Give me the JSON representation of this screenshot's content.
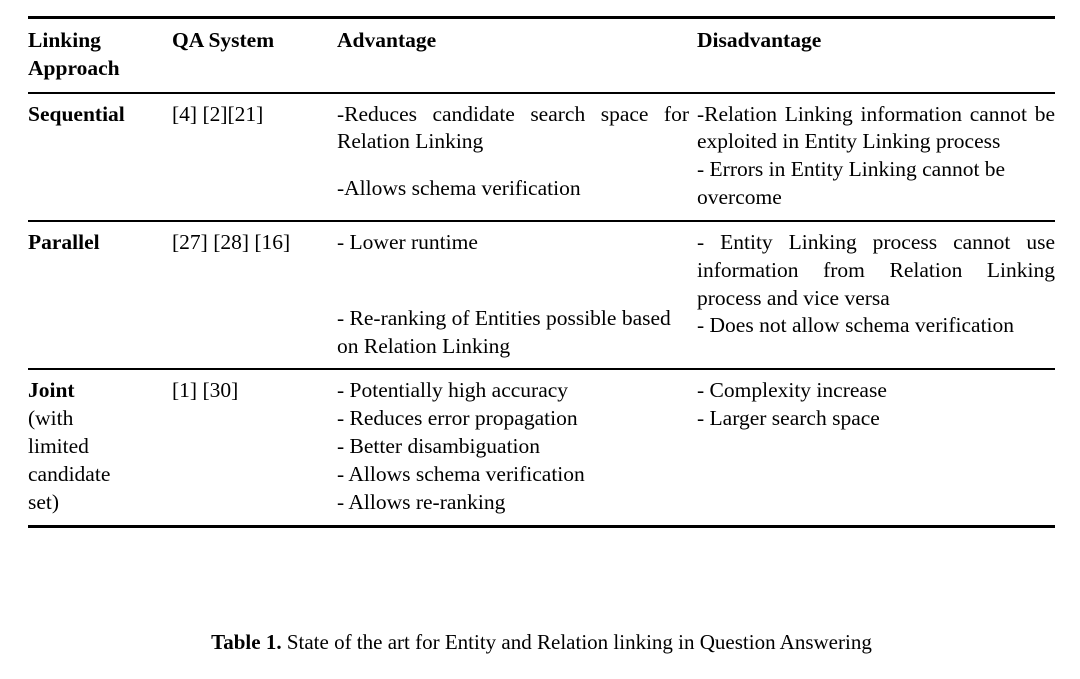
{
  "table": {
    "columns": [
      {
        "key": "approach",
        "label": "Linking\nApproach",
        "label_line1": "Linking",
        "label_line2": "Approach"
      },
      {
        "key": "qa_system",
        "label": "QA System"
      },
      {
        "key": "advantage",
        "label": "Advantage"
      },
      {
        "key": "disadvantage",
        "label": "Disadvantage"
      }
    ],
    "header": {
      "approach_line1": "Linking",
      "approach_line2": "Approach",
      "qa_system": "QA System",
      "advantage": "Advantage",
      "disadvantage": "Disadvantage"
    },
    "rows": [
      {
        "approach": "Sequential",
        "approach_sub": "",
        "qa_system": "[4] [2][21]",
        "advantages": [
          "-Reduces candidate search space for Relation Linking",
          "-Allows schema verification"
        ],
        "disadvantages": [
          "-Relation Linking information cannot be exploited in Entity Linking process",
          "- Errors in Entity Linking cannot be overcome"
        ]
      },
      {
        "approach": "Parallel",
        "approach_sub": "",
        "qa_system": "[27] [28] [16]",
        "advantages": [
          "- Lower runtime",
          "- Re-ranking of Entities possible based on Relation Linking"
        ],
        "disadvantages": [
          "- Entity Linking process cannot use information from Relation Linking process and vice versa",
          "- Does not allow schema verification"
        ]
      },
      {
        "approach": "Joint",
        "approach_sub_lines": [
          "(with",
          "limited",
          "candidate",
          "set)"
        ],
        "qa_system": "[1] [30]",
        "advantages": [
          "- Potentially high accuracy",
          "- Reduces error propagation",
          "- Better disambiguation",
          "- Allows schema verification",
          "- Allows re-ranking"
        ],
        "disadvantages": [
          "- Complexity increase",
          "- Larger search space"
        ]
      }
    ]
  },
  "caption": {
    "label": "Table 1.",
    "text": "State of the art for Entity and Relation linking in Question Answering"
  }
}
